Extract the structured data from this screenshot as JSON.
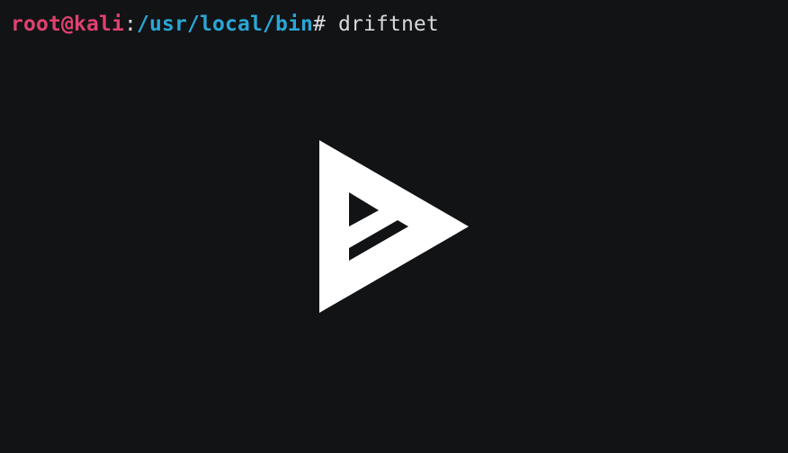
{
  "terminal": {
    "prompt": {
      "user_host": "root@kali",
      "colon": ":",
      "path": "/usr/local/bin",
      "symbol": "# ",
      "command": "driftnet"
    }
  },
  "colors": {
    "background": "#121315",
    "user_host": "#e0416f",
    "path": "#2aa7d6",
    "text": "#d9d9d9",
    "logo": "#ffffff"
  },
  "overlay": {
    "icon": "asciinema-play-icon"
  }
}
